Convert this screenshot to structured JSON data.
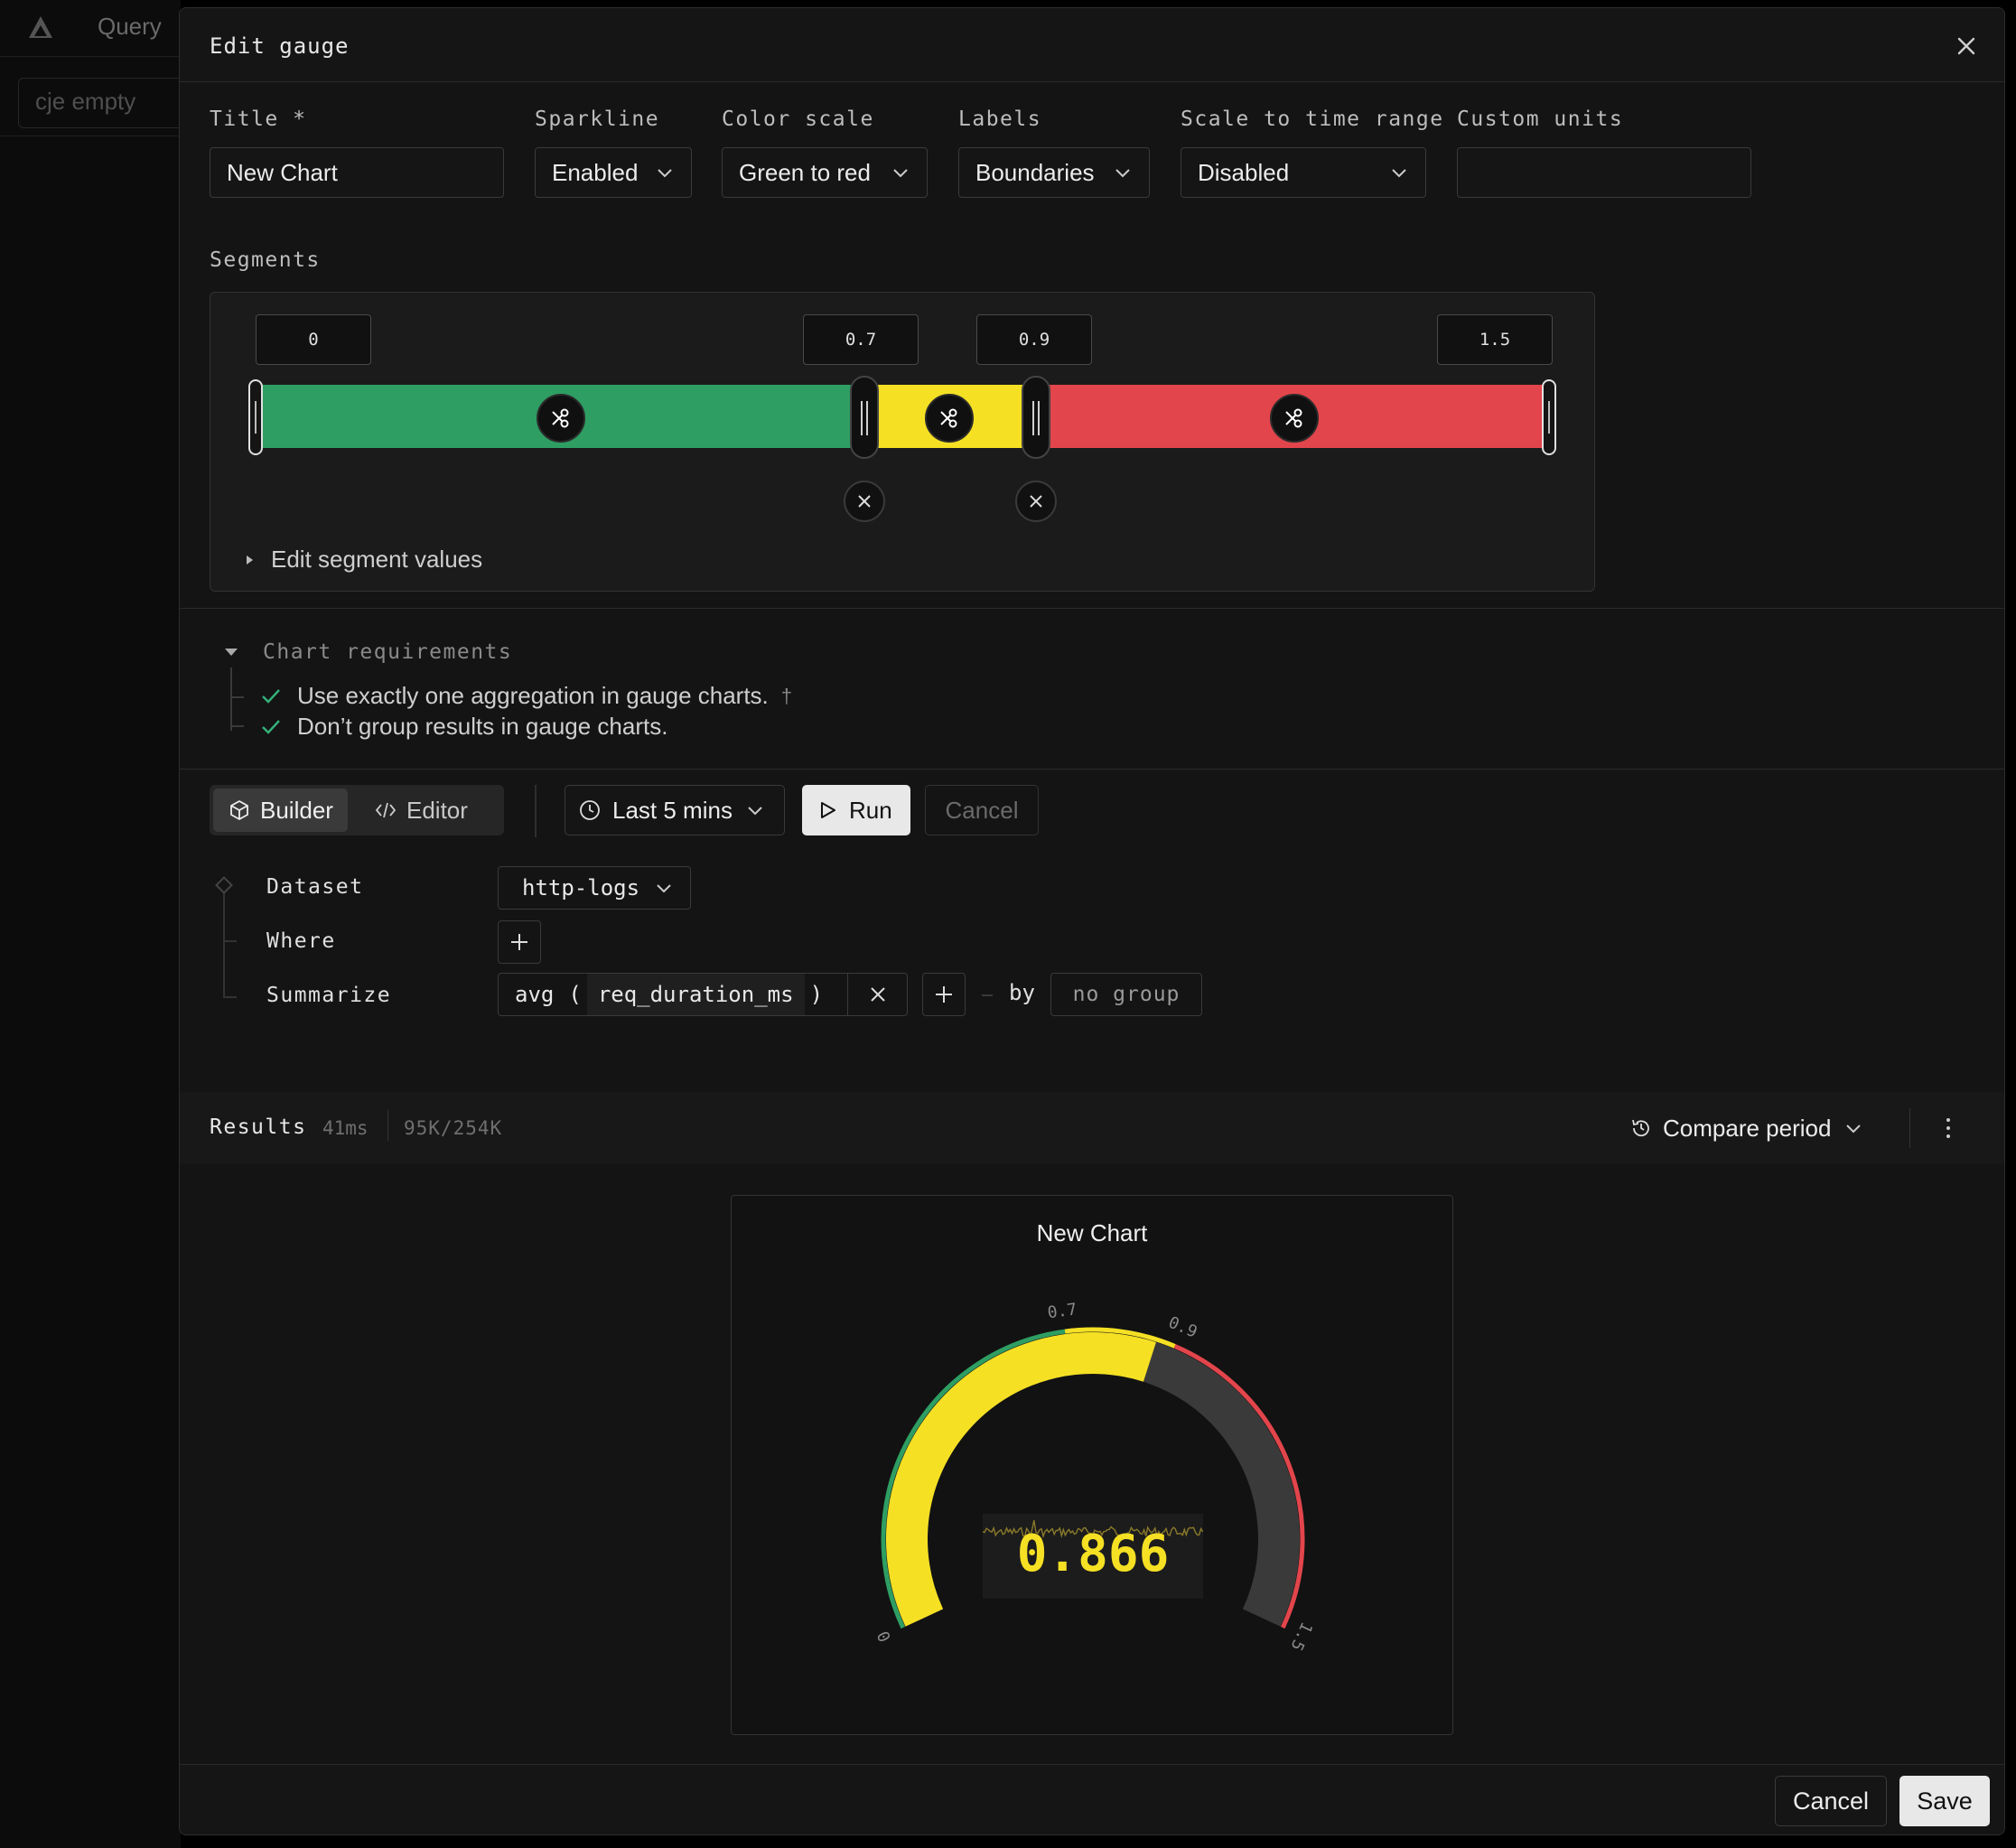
{
  "background": {
    "nav_label": "Query",
    "placeholder_item": "cje empty"
  },
  "modal": {
    "title": "Edit gauge",
    "fields": {
      "title": {
        "label": "Title *",
        "value": "New Chart"
      },
      "sparkline": {
        "label": "Sparkline",
        "value": "Enabled"
      },
      "color_scale": {
        "label": "Color scale",
        "value": "Green to red"
      },
      "labels": {
        "label": "Labels",
        "value": "Boundaries"
      },
      "scale_to_time_range": {
        "label": "Scale to time range",
        "value": "Disabled"
      },
      "custom_units": {
        "label": "Custom units",
        "value": ""
      }
    },
    "segments": {
      "label": "Segments",
      "boundaries": [
        "0",
        "0.7",
        "0.9",
        "1.5"
      ],
      "colors": [
        "#2e9e63",
        "#f5e024",
        "#e2454b"
      ],
      "edit_values_label": "Edit segment values"
    },
    "requirements": {
      "heading": "Chart requirements",
      "items": [
        "Use exactly one aggregation in gauge charts.",
        "Don’t group results in gauge charts."
      ],
      "footnote_mark": "†"
    },
    "query": {
      "mode_builder": "Builder",
      "mode_editor": "Editor",
      "time_range": "Last 5 mins",
      "run_label": "Run",
      "cancel_label": "Cancel",
      "dataset_label": "Dataset",
      "dataset_value": "http-logs",
      "where_label": "Where",
      "summarize_label": "Summarize",
      "agg_fn": "avg",
      "agg_open": "(",
      "agg_field": "req_duration_ms",
      "agg_close": ")",
      "by_label": "by",
      "group_value": "no group"
    },
    "results": {
      "title": "Results",
      "duration": "41ms",
      "rows": "95K/254K",
      "compare_label": "Compare period"
    },
    "chart": {
      "title": "New Chart",
      "value_text": "0.866",
      "value": 0.866,
      "tick_labels": [
        "0",
        "0.7",
        "0.9",
        "1.5"
      ]
    },
    "footer": {
      "cancel_label": "Cancel",
      "save_label": "Save"
    }
  },
  "chart_data": {
    "type": "gauge",
    "title": "New Chart",
    "min": 0,
    "max": 1.5,
    "value": 0.866,
    "thresholds": [
      0.7,
      0.9
    ],
    "segment_colors": [
      "#2e9e63",
      "#f5e024",
      "#e2454b"
    ]
  }
}
